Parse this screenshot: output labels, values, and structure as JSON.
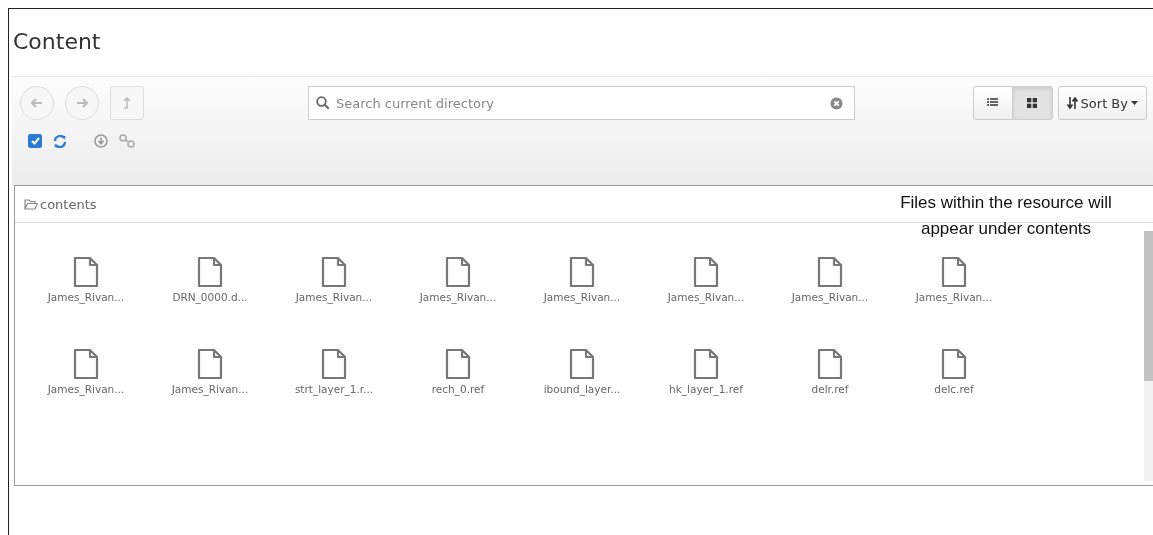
{
  "title": "Content",
  "nav_buttons": [
    {
      "kind": "back",
      "disabled": true
    },
    {
      "kind": "forward",
      "disabled": true
    },
    {
      "kind": "up",
      "disabled": true
    }
  ],
  "search": {
    "placeholder": "Search current directory"
  },
  "view_modes": [
    {
      "kind": "list",
      "selected": false
    },
    {
      "kind": "grid",
      "selected": true
    }
  ],
  "sort_button": {
    "label": "Sort By"
  },
  "select_all": {
    "checked": true
  },
  "breadcrumb": "contents",
  "note": "Files within the resource will appear under contents",
  "files": [
    {
      "name": "James_Rivan..."
    },
    {
      "name": "DRN_0000.d..."
    },
    {
      "name": "James_Rivan..."
    },
    {
      "name": "James_Rivan..."
    },
    {
      "name": "James_Rivan..."
    },
    {
      "name": "James_Rivan..."
    },
    {
      "name": "James_Rivan..."
    },
    {
      "name": "James_Rivan..."
    },
    {
      "name": "James_Rivan..."
    },
    {
      "name": "James_Rivan..."
    },
    {
      "name": "strt_layer_1.r..."
    },
    {
      "name": "rech_0.ref"
    },
    {
      "name": "ibound_layer..."
    },
    {
      "name": "hk_layer_1.ref"
    },
    {
      "name": "delr.ref"
    },
    {
      "name": "delc.ref"
    }
  ]
}
